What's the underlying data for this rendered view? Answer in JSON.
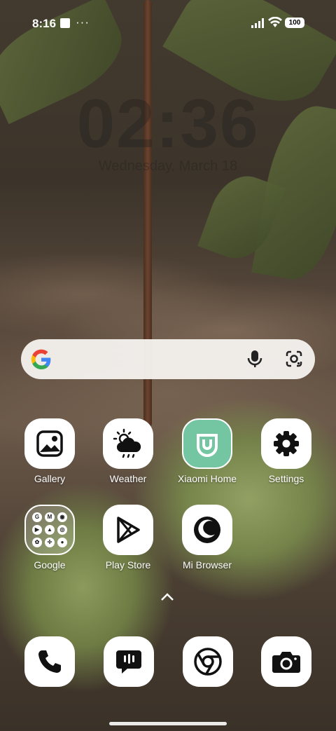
{
  "status_bar": {
    "time": "8:16",
    "more": "···",
    "battery": "100"
  },
  "lock": {
    "clock": "02:36",
    "date": "Wednesday, March 18"
  },
  "search": {
    "placeholder": ""
  },
  "apps": [
    {
      "name": "gallery",
      "label": "Gallery",
      "icon": "gallery-icon"
    },
    {
      "name": "weather",
      "label": "Weather",
      "icon": "weather-icon"
    },
    {
      "name": "xiaomi-home",
      "label": "Xiaomi Home",
      "icon": "xiaomi-home-icon"
    },
    {
      "name": "settings",
      "label": "Settings",
      "icon": "gear-icon"
    },
    {
      "name": "google-folder",
      "label": "Google",
      "icon": "folder-icon"
    },
    {
      "name": "play-store",
      "label": "Play Store",
      "icon": "play-store-icon"
    },
    {
      "name": "mi-browser",
      "label": "Mi Browser",
      "icon": "mi-browser-icon"
    }
  ],
  "dock": [
    {
      "name": "phone",
      "icon": "phone-icon"
    },
    {
      "name": "messages",
      "icon": "message-icon"
    },
    {
      "name": "chrome",
      "icon": "chrome-icon"
    },
    {
      "name": "camera",
      "icon": "camera-icon"
    }
  ],
  "colors": {
    "xiaomi_home_bg": "#74c6a3",
    "icon_bg": "#ffffff",
    "accent_google_blue": "#4285F4",
    "accent_google_red": "#EA4335",
    "accent_google_yellow": "#FBBC05",
    "accent_google_green": "#34A853"
  }
}
